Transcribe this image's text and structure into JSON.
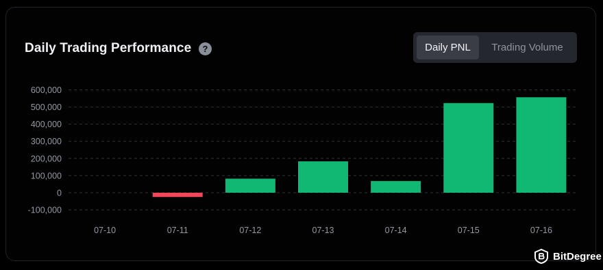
{
  "header": {
    "title": "Daily Trading Performance",
    "help_glyph": "?"
  },
  "toggle": {
    "options": [
      "Daily PNL",
      "Trading Volume"
    ],
    "selected": "Daily PNL"
  },
  "colors": {
    "positive": "#10b873",
    "negative": "#f0465a",
    "grid": "#2e3138",
    "tick": "#9499a3"
  },
  "chart_data": {
    "type": "bar",
    "categories": [
      "07-10",
      "07-11",
      "07-12",
      "07-13",
      "07-14",
      "07-15",
      "07-16"
    ],
    "values": [
      0,
      -25000,
      82000,
      183000,
      68000,
      523000,
      557000
    ],
    "ylim": [
      -100000,
      600000
    ],
    "yticks": [
      600000,
      500000,
      400000,
      300000,
      200000,
      100000,
      0,
      -100000
    ],
    "ytick_labels": [
      "600,000",
      "500,000",
      "400,000",
      "300,000",
      "200,000",
      "100,000",
      "0",
      "-100,000"
    ],
    "grid": true,
    "title": "",
    "xlabel": "",
    "ylabel": ""
  },
  "watermark": {
    "text": "BitDegree",
    "icon": "bitdegree-logo-icon"
  }
}
